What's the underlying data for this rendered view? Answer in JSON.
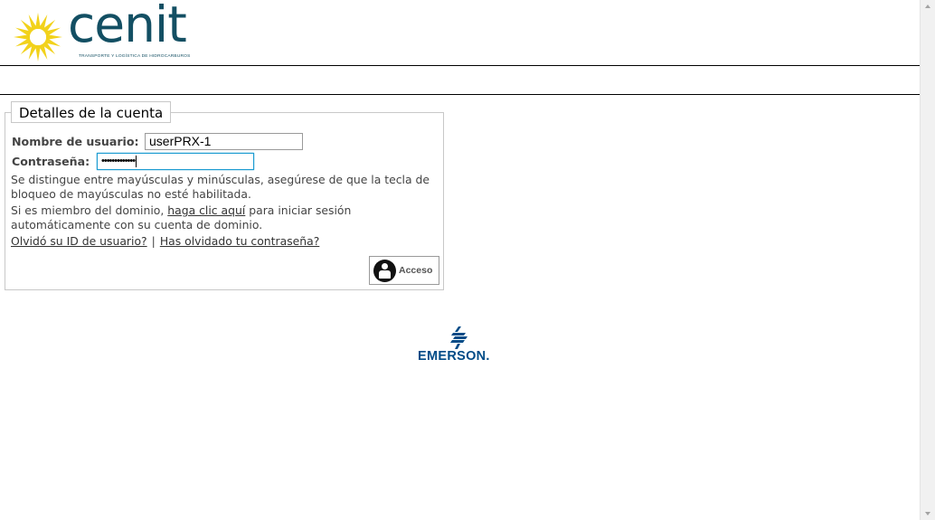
{
  "header": {
    "logo_word": "cenit",
    "logo_tagline": "TRANSPORTE Y LOGÍSTICA DE HIDROCARBUROS"
  },
  "account": {
    "legend": "Detalles de la cuenta",
    "username_label": "Nombre de usuario:",
    "username_value": "userPRX-1",
    "password_label": "Contraseña:",
    "password_value": "•••••••••••••",
    "case_note_line1": "Se distingue entre mayúsculas y minúsculas, asegúrese de que la tecla de",
    "case_note_line2": "bloqueo de mayúsculas no esté habilitada.",
    "domain_text_before": "Si es miembro del dominio, ",
    "domain_link": "haga clic aquí",
    "domain_text_after": " para iniciar sesión",
    "domain_text_line2": "automáticamente con su cuenta de dominio.",
    "forgot_id_link": "Olvidó su ID de usuario?",
    "separator": "|",
    "forgot_password_link": "Has olvidado tu contraseña?",
    "login_button": "Acceso"
  },
  "footer": {
    "brand": "EMERSON."
  },
  "colors": {
    "cenit_blue": "#134f63",
    "cenit_yellow": "#f2d21b",
    "emerson_blue": "#004b87",
    "focus_border": "#1b9bd1"
  }
}
